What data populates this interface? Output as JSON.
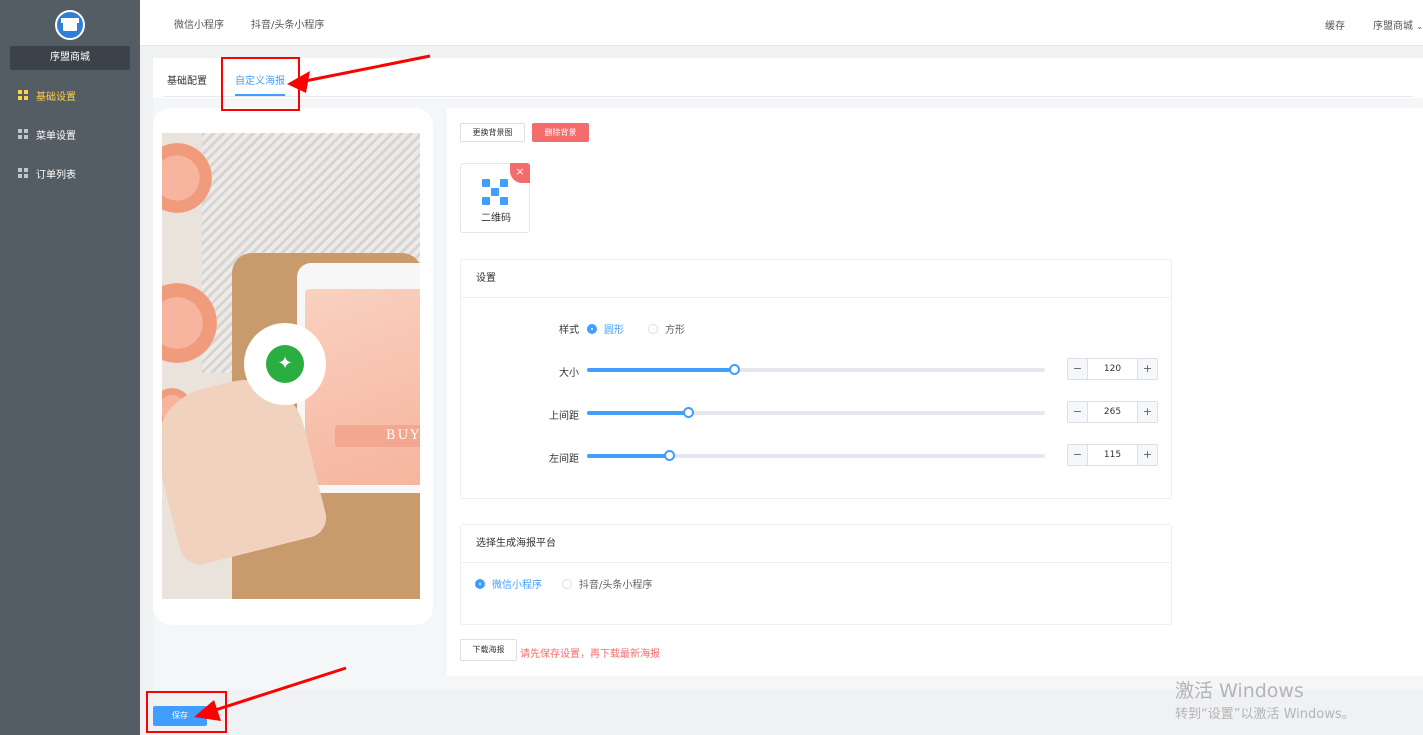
{
  "sidebar": {
    "shop_name": "序盟商城",
    "items": [
      {
        "label": "基础设置",
        "active": true
      },
      {
        "label": "菜单设置",
        "active": false
      },
      {
        "label": "订单列表",
        "active": false
      }
    ]
  },
  "topbar": {
    "tabs": [
      "微信小程序",
      "抖音/头条小程序"
    ],
    "cache_label": "缓存",
    "user_label": "序盟商城"
  },
  "page_tabs": [
    {
      "label": "基础配置",
      "active": false
    },
    {
      "label": "自定义海报",
      "active": true
    }
  ],
  "editor": {
    "change_bg_label": "更换背景图",
    "delete_bg_label": "删除背景",
    "qr_label": "二维码",
    "delete_icon": "×"
  },
  "settings": {
    "title": "设置",
    "style_label": "样式",
    "style_options": [
      {
        "label": "圆形",
        "checked": true
      },
      {
        "label": "方形",
        "checked": false
      }
    ],
    "size": {
      "label": "大小",
      "value": "120",
      "fraction": 0.32
    },
    "top": {
      "label": "上间距",
      "value": "265",
      "fraction": 0.22
    },
    "left": {
      "label": "左间距",
      "value": "115",
      "fraction": 0.18
    },
    "minus": "−",
    "plus": "+"
  },
  "platform": {
    "title": "选择生成海报平台",
    "options": [
      {
        "label": "微信小程序",
        "checked": true
      },
      {
        "label": "抖音/头条小程序",
        "checked": false
      }
    ]
  },
  "download": {
    "button_label": "下载海报",
    "warning": "请先保存设置，再下载最新海报"
  },
  "poster": {
    "buy_text": "BUY"
  },
  "save_label": "保存",
  "watermark": {
    "line1": "激活 Windows",
    "line2": "转到“设置”以激活 Windows。"
  },
  "colors": {
    "accent": "#409eff",
    "danger": "#f56c6c",
    "sidebar": "#545c64",
    "annotation": "#ff0000"
  }
}
